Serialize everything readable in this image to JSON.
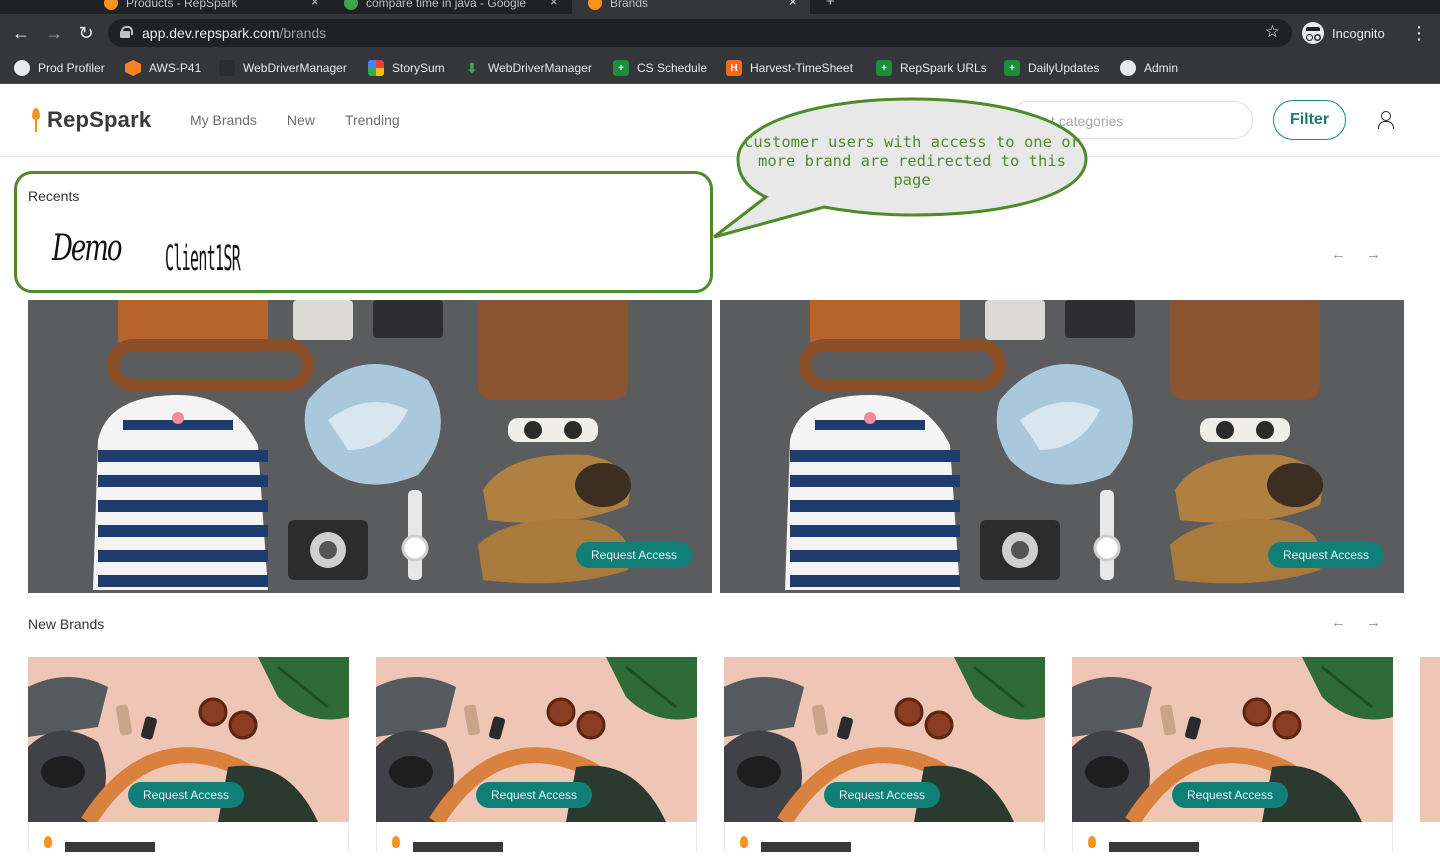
{
  "browser": {
    "tabs": [
      {
        "label": "Products - RepSpark",
        "close": "×"
      },
      {
        "label": "compare time in java - Google",
        "close": "×"
      },
      {
        "label": "Brands",
        "close": "×"
      }
    ],
    "new_tab": "+",
    "url_host": "app.dev.repspark.com",
    "url_path": "/brands",
    "profile_label": "Incognito",
    "bookmarks": [
      {
        "label": "Prod Profiler",
        "icon": "globe-icon"
      },
      {
        "label": "AWS-P41",
        "icon": "aws-cube-icon"
      },
      {
        "label": "WebDriverManager",
        "icon": "dark-app-icon"
      },
      {
        "label": "StorySum",
        "icon": "multicolor-icon"
      },
      {
        "label": "WebDriverManager",
        "icon": "download-icon"
      },
      {
        "label": "CS Schedule",
        "icon": "sheets-icon"
      },
      {
        "label": "Harvest-TimeSheet",
        "icon": "harvest-icon"
      },
      {
        "label": "RepSpark URLs",
        "icon": "sheets-icon"
      },
      {
        "label": "DailyUpdates",
        "icon": "sheets-icon"
      },
      {
        "label": "Admin",
        "icon": "globe-icon"
      }
    ]
  },
  "app": {
    "logo": "RepSpark",
    "nav": [
      "My Brands",
      "New",
      "Trending"
    ],
    "search_placeholder": "t categories",
    "filter_label": "Filter"
  },
  "recents": {
    "title": "Recents",
    "brands": [
      "Demo",
      "Client1SR"
    ],
    "prev_arrow": "←",
    "next_arrow": "→"
  },
  "callout": {
    "text": "Customer users with access to one or more brand are redirected to this page",
    "color": "#4f8b2b"
  },
  "featured": {
    "cards": [
      {
        "button": "Request Access"
      },
      {
        "button": "Request Access"
      }
    ]
  },
  "new_brands": {
    "title": "New Brands",
    "prev_arrow": "←",
    "next_arrow": "→",
    "cards": [
      {
        "button": "Request Access"
      },
      {
        "button": "Request Access"
      },
      {
        "button": "Request Access"
      },
      {
        "button": "Request Access"
      }
    ]
  },
  "colors": {
    "accent_teal": "#0f7f78",
    "annotation_green": "#4e8a2a"
  }
}
